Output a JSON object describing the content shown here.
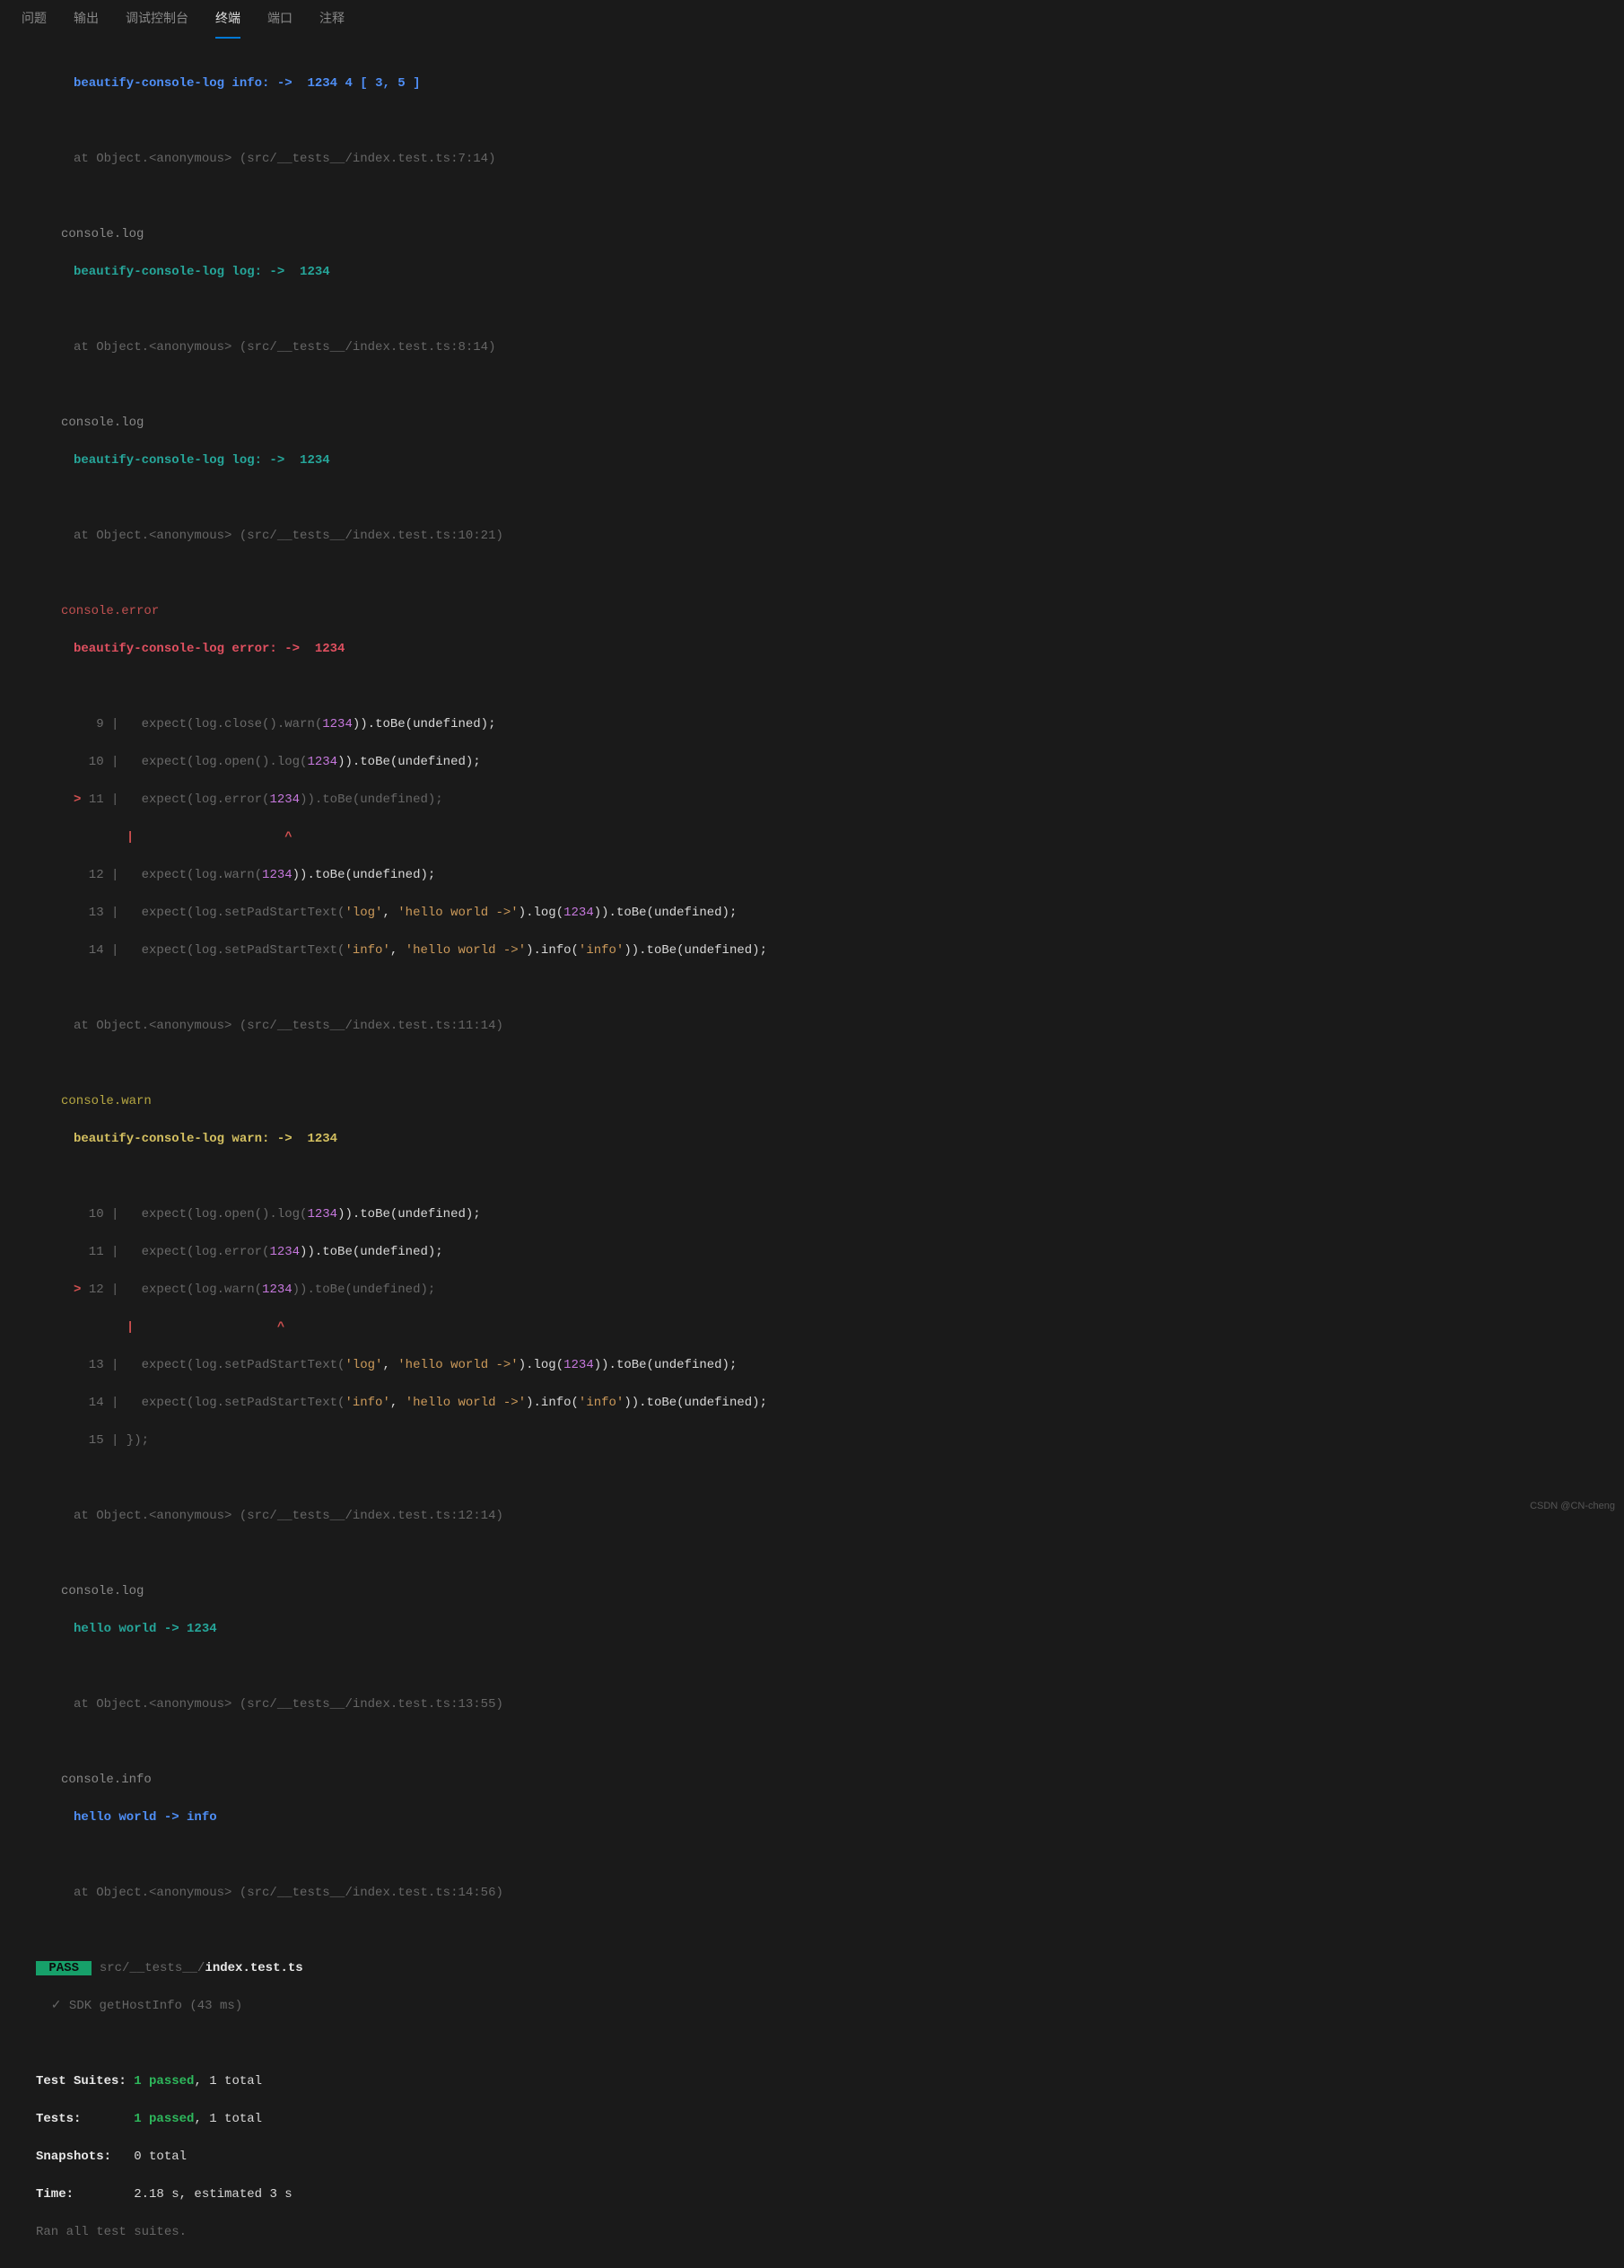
{
  "tabs": {
    "problems": "问题",
    "output": "输出",
    "debug": "调试控制台",
    "terminal": "终端",
    "ports": "端口",
    "comments": "注释"
  },
  "infoLine": {
    "prefix": "beautify-console-log info: ->  ",
    "rest": "1234 4 [ 3, 5 ]"
  },
  "trace7": "at Object.<anonymous> (src/__tests__/index.test.ts:7:14)",
  "consoleLog": "console.log",
  "logLine": "beautify-console-log log: ->  1234",
  "trace8": "at Object.<anonymous> (src/__tests__/index.test.ts:8:14)",
  "trace10": "at Object.<anonymous> (src/__tests__/index.test.ts:10:21)",
  "consoleError": "console.error",
  "errorLine": "beautify-console-log error: ->  1234",
  "err": {
    "l9": "   9 |   expect(log.close().warn(",
    "l9b": ")).toBe(undefined);",
    "l10": "  10 |   expect(log.open().log(",
    "l10b": ")).toBe(undefined);",
    "l11pre": "> ",
    "l11": "11 |   expect(log.error(",
    "l11b": ")).toBe(undefined);",
    "caret": "     |                    ^",
    "l12": "  12 |   expect(log.warn(",
    "l12b": ")).toBe(undefined);",
    "l13": "  13 |   expect(log.setPadStartText(",
    "l13s1": "'log'",
    "l13s2": "'hello world ->'",
    "l13mid": ").log(",
    "l13end": ")).toBe(undefined);",
    "l14": "  14 |   expect(log.setPadStartText(",
    "l14s1": "'info'",
    "l14s2": "'hello world ->'",
    "l14mid": ").info(",
    "l14s3": "'info'",
    "l14end": ")).toBe(undefined);",
    "num": "1234"
  },
  "trace11": "at Object.<anonymous> (src/__tests__/index.test.ts:11:14)",
  "consoleWarn": "console.warn",
  "warnLine": "beautify-console-log warn: ->  1234",
  "warn": {
    "l10": "  10 |   expect(log.open().log(",
    "l10b": ")).toBe(undefined);",
    "l11": "  11 |   expect(log.error(",
    "l11b": ")).toBe(undefined);",
    "l12pre": "> ",
    "l12": "12 |   expect(log.warn(",
    "l12b": ")).toBe(undefined);",
    "caret": "     |                   ^",
    "l13": "  13 |   expect(log.setPadStartText(",
    "l13mid": ").log(",
    "l13end": ")).toBe(undefined);",
    "l14": "  14 |   expect(log.setPadStartText(",
    "l14mid": ").info(",
    "l14end": ")).toBe(undefined);",
    "l15": "  15 | });"
  },
  "trace12": "at Object.<anonymous> (src/__tests__/index.test.ts:12:14)",
  "helloLog": "hello world -> 1234",
  "trace13": "at Object.<anonymous> (src/__tests__/index.test.ts:13:55)",
  "consoleInfo": "console.info",
  "helloInfo": "hello world -> info",
  "trace14": "at Object.<anonymous> (src/__tests__/index.test.ts:14:56)",
  "pass": {
    "badge": " PASS ",
    "path": " src/__tests__/",
    "file": "index.test.ts",
    "testLine": "  ✓ SDK getHostInfo (43 ms)"
  },
  "summary": {
    "suitesLabel": "Test Suites: ",
    "suitesVal": "1 passed",
    "suitesTotal": ", 1 total",
    "testsLabel": "Tests:       ",
    "testsVal": "1 passed",
    "testsTotal": ", 1 total",
    "snapLabel": "Snapshots:   ",
    "snapVal": "0 total",
    "timeLabel": "Time:        ",
    "timeVal": "2.18 s, estimated 3 s",
    "ran": "Ran all test suites."
  },
  "watermark": "CSDN @CN-cheng"
}
